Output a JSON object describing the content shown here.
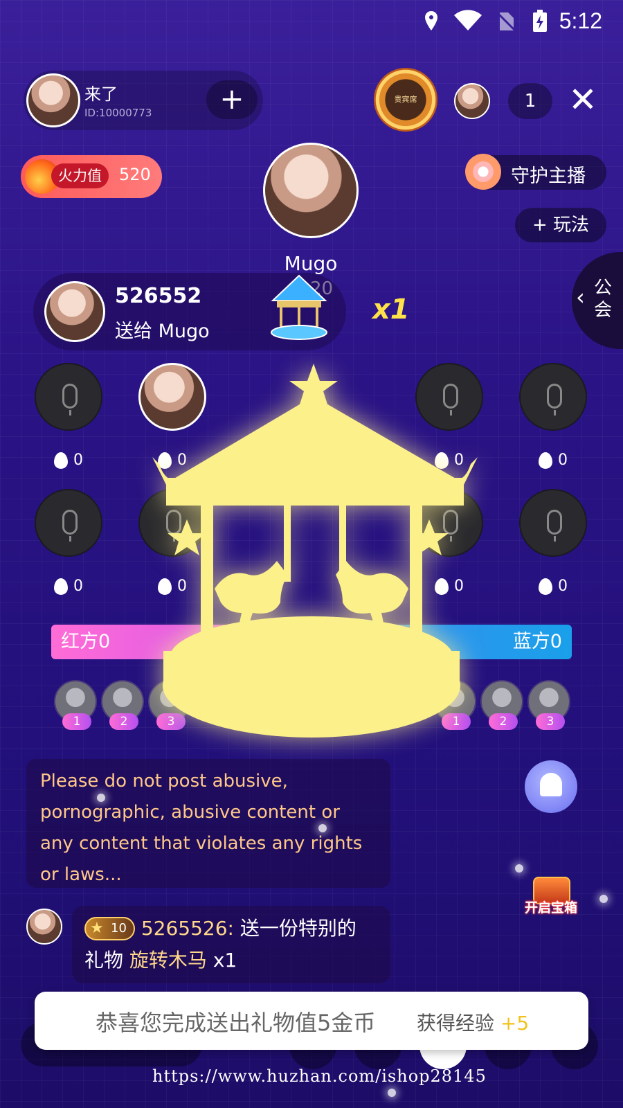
{
  "status_bar": {
    "time": "5:12"
  },
  "host": {
    "name": "来了",
    "id": "ID:10000773",
    "follow_label": "+"
  },
  "vip_badge": "贵宾席",
  "viewer_count": "1",
  "close_label": "✕",
  "fire": {
    "label": "火力值",
    "value": "520"
  },
  "guard_label": "守护主播",
  "play_label": "+ 玩法",
  "guild_label": "公会",
  "anchor": {
    "name": "Mugo",
    "score_partial": "20"
  },
  "gift_banner": {
    "sender": "526552",
    "to": "送给 Mugo",
    "count": "x1"
  },
  "seats": {
    "row1_scores": [
      "0",
      "0",
      "0",
      "0"
    ],
    "row2_scores": [
      "0",
      "0",
      "0",
      "0"
    ]
  },
  "pk": {
    "red": "红方0",
    "blue": "蓝方0"
  },
  "ranks": {
    "red": [
      "1",
      "2",
      "3"
    ],
    "blue": [
      "1",
      "2",
      "3"
    ]
  },
  "notice": "Please do not post abusive, pornographic, abusive content or any content that violates any rights or laws...",
  "treasure_label": "开启宝箱",
  "chat": {
    "level": "10",
    "user": "5265526:",
    "text1": " 送一份特别的",
    "text2": "礼物 ",
    "gift": "旋转木马",
    "qty": " x1"
  },
  "toast": {
    "main": "恭喜您完成送出礼物值5金币",
    "exp_label": "获得经验 ",
    "exp_value": "+5"
  },
  "watermark": "https://www.huzhan.com/ishop28145",
  "colors": {
    "accent_red": "#ff6cd6",
    "accent_blue": "#1aa0ea",
    "notice_text": "#ffc88a",
    "gift_yellow": "#ffe14a"
  }
}
